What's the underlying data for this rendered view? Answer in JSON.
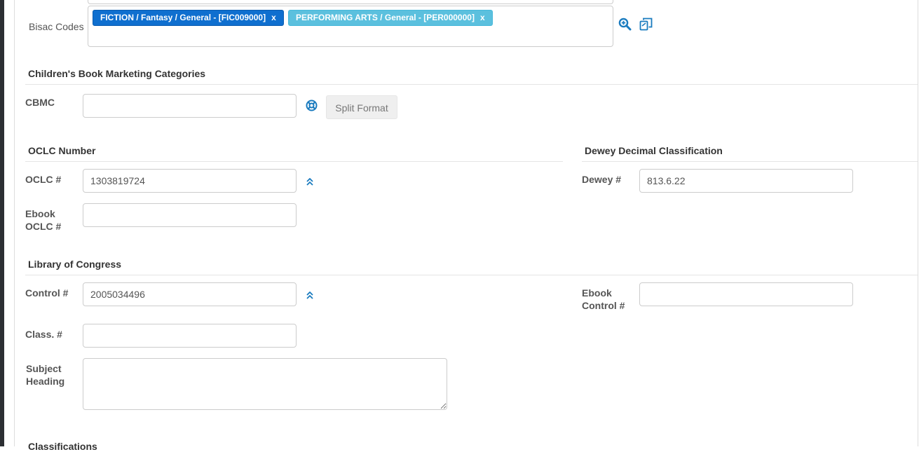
{
  "bisac": {
    "label": "Bisac Codes",
    "tags": [
      {
        "text": "FICTION / Fantasy / General - [FIC009000]",
        "close": "x"
      },
      {
        "text": "PERFORMING ARTS / General - [PER000000]",
        "close": "x"
      }
    ],
    "icons": [
      "zoom-in-icon",
      "copy-icon"
    ]
  },
  "cbmc_section": {
    "title": "Children's Book Marketing Categories",
    "field_label": "CBMC",
    "value": "",
    "split_button": "Split Format",
    "icon": "lifebuoy-icon"
  },
  "oclc_section": {
    "title": "OCLC Number",
    "oclc_label": "OCLC #",
    "oclc_value": "1303819724",
    "ebook_label_line1": "Ebook",
    "ebook_label_line2": "OCLC #",
    "ebook_value": "",
    "icon": "double-chevron-up-icon"
  },
  "dewey_section": {
    "title": "Dewey Decimal Classification",
    "label": "Dewey #",
    "value": "813.6.22"
  },
  "loc_section": {
    "title": "Library of Congress",
    "control_label": "Control #",
    "control_value": "2005034496",
    "ebook_control_line1": "Ebook",
    "ebook_control_line2": "Control #",
    "ebook_control_value": "",
    "class_label": "Class. #",
    "class_value": "",
    "subject_line1": "Subject",
    "subject_line2": "Heading",
    "subject_value": "",
    "icon": "double-chevron-up-icon"
  },
  "classifications": {
    "title": "Classifications"
  },
  "colors": {
    "accent": "#1a7bbf",
    "tag_primary": "#0f6fcf",
    "tag_info": "#5bc0de"
  }
}
